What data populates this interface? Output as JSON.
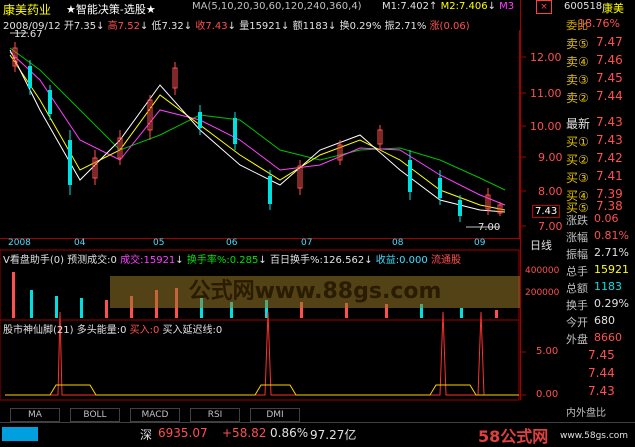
{
  "colors": {
    "up": "#ff5050",
    "down": "#00e000",
    "panel_border": "#a00000",
    "accent": "#ffff00"
  },
  "stock": {
    "name": "康美药业",
    "indicator_title": "★智能决策-选股★",
    "ma_params": "MA(5,10,20,30,60,120,240,360,4)",
    "m1": "M1:7.402",
    "m1_arrow": "↑",
    "m2": "M2:7.406",
    "m2_arrow": "↓",
    "m3": "M3",
    "date": "2008/09/12",
    "open": "开7.35",
    "open_arrow": "↓",
    "high": "高7.52",
    "high_arrow": "↓",
    "low": "低7.32",
    "low_arrow": "↓",
    "close": "收7.43",
    "close_arrow": "↓",
    "vol": "量15921",
    "vol_arrow": "↓",
    "amount": "额1183",
    "amount_arrow": "↓",
    "turnover": "换0.29%",
    "amplitude": "振2.71%",
    "change": "涨(0.06)",
    "start_label": "12.67",
    "low_label": "7.00",
    "last_price_tag": "7.43"
  },
  "price_axis": [
    "12.00",
    "11.00",
    "10.00",
    "9.00",
    "8.00",
    "7.00"
  ],
  "months": [
    "2008",
    "04",
    "05",
    "06",
    "07",
    "08",
    "09"
  ],
  "x_axis_label": "日线",
  "volume_panel": {
    "title": "V看盘助手(0) 预测成交:0",
    "cj_label": "成交:",
    "cj_value": "15921",
    "cj_arrow": "↓",
    "hsl": "换手率%:0.285",
    "hsl_arrow": "↓",
    "bh": "百日换手%:126.562",
    "bh_arrow": "↓",
    "sy": "收益:0.000",
    "lt": "流通股",
    "axis": [
      "400000",
      "200000"
    ],
    "watermark": "公式网www.88gs.com"
  },
  "osc_panel": {
    "title": "股市神仙脚(21) 多头能量:0",
    "buy_in": "买入:0",
    "buy_ext": "买入延迟线:0",
    "axis": [
      "5.00",
      "0.00"
    ]
  },
  "tabs": [
    "MA",
    "BOLL",
    "MACD",
    "RSI",
    "DMI"
  ],
  "index_bar": {
    "name": "深",
    "value": "6935.07",
    "change": "+58.82",
    "pct": "0.86%",
    "amount": "97.27亿"
  },
  "site_watermark": "58公式网",
  "site_url": "www.58gs.com",
  "side": {
    "code": "600518",
    "name": "康美",
    "wb": "委比",
    "wb_value": "-18.76%",
    "sell": [
      {
        "label": "卖⑤",
        "price": "7.47"
      },
      {
        "label": "卖④",
        "price": "7.46"
      },
      {
        "label": "卖③",
        "price": "7.45"
      },
      {
        "label": "卖②",
        "price": "7.44"
      }
    ],
    "latest": {
      "label": "最新",
      "price": "7.43"
    },
    "buy": [
      {
        "label": "买①",
        "price": "7.43"
      },
      {
        "label": "买②",
        "price": "7.42"
      },
      {
        "label": "买③",
        "price": "7.41"
      },
      {
        "label": "买④",
        "price": "7.39"
      },
      {
        "label": "买⑤",
        "price": "7.38"
      }
    ],
    "stats": [
      {
        "label": "涨跌",
        "value": "0.06"
      },
      {
        "label": "涨幅",
        "value": "0.81%"
      },
      {
        "label": "振幅",
        "value": "2.71%"
      },
      {
        "label": "总手",
        "value": "15921"
      },
      {
        "label": "总额",
        "value": "1183"
      },
      {
        "label": "换手",
        "value": "0.29%"
      },
      {
        "label": "今开",
        "value": "680"
      }
    ],
    "outer": {
      "label": "外盘",
      "value": "8660"
    },
    "osc_prices": [
      "7.45",
      "7.44",
      "7.43"
    ],
    "bottom_label": "内外盘比"
  }
}
